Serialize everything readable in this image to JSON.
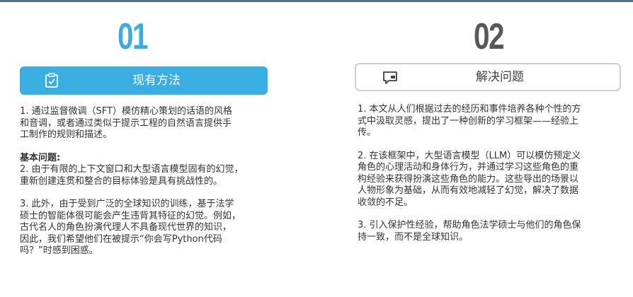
{
  "colors": {
    "accent": "#3aaee2",
    "dark": "#595959",
    "top_line": "#5a6f82"
  },
  "left": {
    "number": "01",
    "title": "现有方法",
    "icon": "clipboard-icon",
    "p1": "1. 通过监督微调（SFT）模仿精心策划的话语的风格\n和音调，或者通过类似于提示工程的自然语言提供手\n工制作的规则和描述。",
    "heading": "基本问题:",
    "p2": "2. 由于有限的上下文窗口和大型语言模型固有的幻觉，\n重新创建连贯和整合的目标体验是具有挑战性的。",
    "p3": "3. 此外，由于受到广泛的全球知识的训练，基于法学\n硕士的智能体很可能会产生违背其特征的幻觉。例如，\n古代名人的角色扮演代理人不具备现代世界的知识，\n因此，我们希望他们在被提示“你会写Python代码\n吗？”时感到困惑。"
  },
  "right": {
    "number": "02",
    "title": "解决问题",
    "icon": "chat-icon",
    "p1": "1. 本文从人们根据过去的经历和事件培养各种个性的方\n式中汲取灵感，提出了一种创新的学习框架——经验上\n传。",
    "p2": "2. 在该框架中，大型语言模型（LLM）可以模仿预定义\n角色的心理活动和身体行为，并通过学习这些角色的重\n构经验来获得扮演这些角色的能力。这些导出的场景以\n人物形象为基础，从而有效地减轻了幻觉，解决了数据\n收敛的不足。",
    "p3": "3. 引入保护性经验，帮助角色法学硕士与他们的角色保\n持一致，而不是全球知识。"
  }
}
